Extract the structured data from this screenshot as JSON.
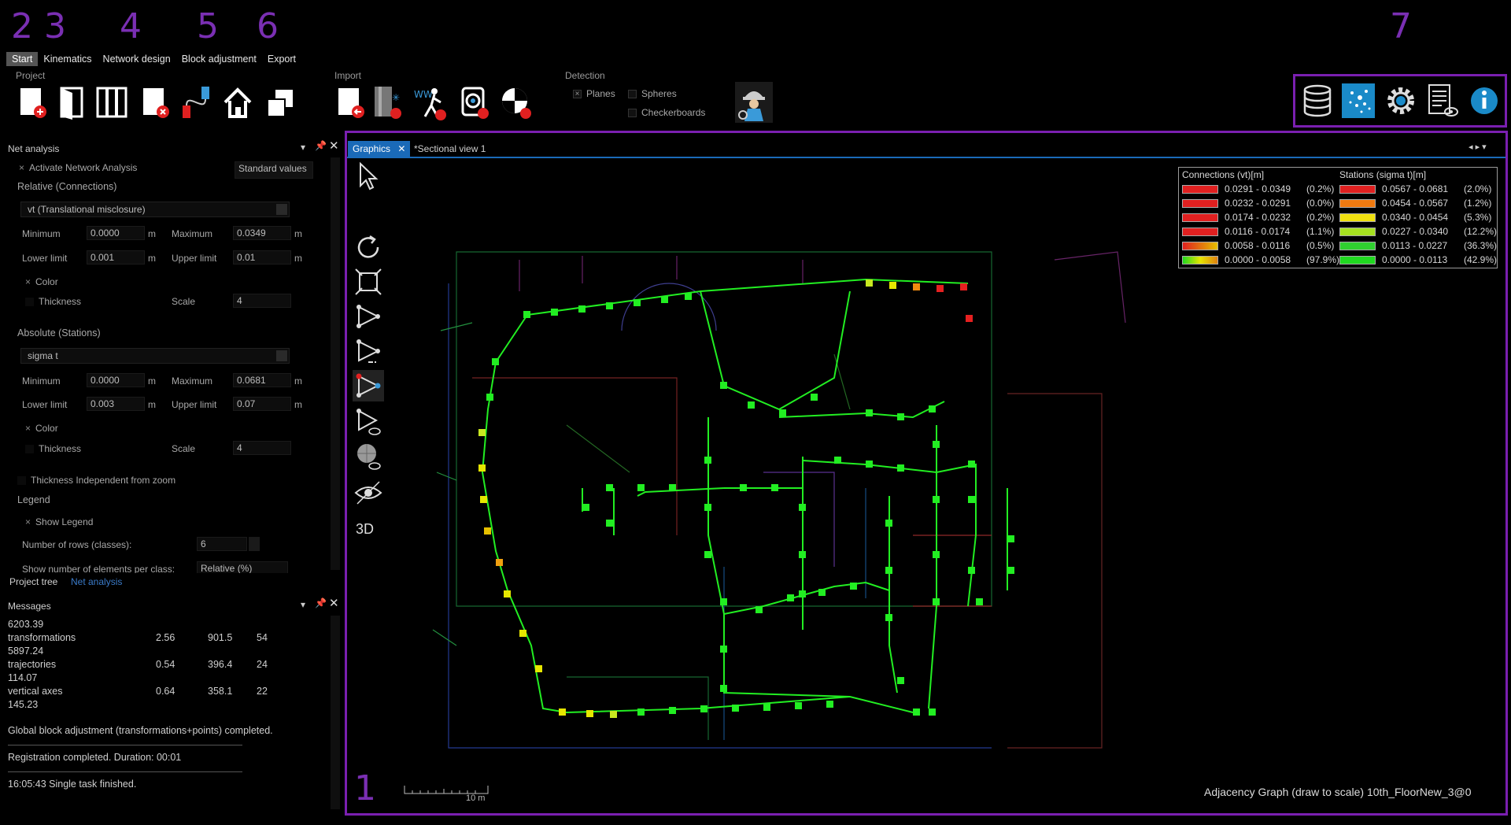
{
  "annotations": [
    "2",
    "3",
    "4",
    "5",
    "6",
    "7",
    "1"
  ],
  "menu": [
    {
      "label": "Start",
      "active": true
    },
    {
      "label": "Kinematics"
    },
    {
      "label": "Network design"
    },
    {
      "label": "Block adjustment"
    },
    {
      "label": "Export"
    }
  ],
  "ribbon": {
    "project_label": "Project",
    "import_label": "Import",
    "detection_label": "Detection",
    "planes": "Planes",
    "spheres": "Spheres",
    "checkerboards": "Checkerboards",
    "planes_checked": "×"
  },
  "net_panel": {
    "title": "Net analysis",
    "activate": "Activate Network Analysis",
    "standard_values": "Standard values",
    "relative_header": "Relative (Connections)",
    "relative_dropdown": "vt (Translational misclosure)",
    "minimum_label": "Minimum",
    "maximum_label": "Maximum",
    "lower_label": "Lower limit",
    "upper_label": "Upper limit",
    "unit": "m",
    "rel_min": "0.0000",
    "rel_max": "0.0349",
    "rel_lower": "0.001",
    "rel_upper": "0.01",
    "color_label": "Color",
    "thickness_label": "Thickness",
    "scale_label": "Scale",
    "rel_scale": "4",
    "absolute_header": "Absolute (Stations)",
    "absolute_dropdown": "sigma t",
    "abs_min": "0.0000",
    "abs_max": "0.0681",
    "abs_lower": "0.003",
    "abs_upper": "0.07",
    "abs_scale": "4",
    "thickness_independent": "Thickness Independent from zoom",
    "legend_header": "Legend",
    "show_legend": "Show Legend",
    "rows_label": "Number of rows (classes):",
    "rows_value": "6",
    "show_number_label": "Show number of elements per class:",
    "show_number_value": "Relative (%)",
    "tab_project_tree": "Project tree",
    "tab_net_analysis": "Net analysis"
  },
  "messages": {
    "title": "Messages",
    "lines": [
      {
        "text": "6203.39"
      },
      {
        "text": "transformations",
        "c1": "2.56",
        "c2": "901.5",
        "c3": "54"
      },
      {
        "text": "5897.24"
      },
      {
        "text": "trajectories",
        "c1": "0.54",
        "c2": "396.4",
        "c3": "24"
      },
      {
        "text": "114.07"
      },
      {
        "text": "vertical axes",
        "c1": "0.64",
        "c2": "358.1",
        "c3": "22"
      },
      {
        "text": "145.23"
      }
    ],
    "block_done": "Global block adjustment (transformations+points) completed.",
    "registration": "Registration completed. Duration: 00:01",
    "single_task": "16:05:43 Single task finished."
  },
  "graphics": {
    "tab_graphics": "Graphics",
    "tab_sectional": "*Sectional view 1",
    "tool_3d": "3D",
    "scale_bar": "10 m",
    "status": "Adjacency Graph (draw to scale) 10th_FloorNew_3@0"
  },
  "legend": {
    "conn_header": "Connections (vt)[m]",
    "stat_header": "Stations (sigma t)[m]",
    "conn": [
      {
        "range": "0.0291 - 0.0349",
        "pct": "(0.2%)",
        "color": "#e02020"
      },
      {
        "range": "0.0232 - 0.0291",
        "pct": "(0.0%)",
        "color": "#e02020"
      },
      {
        "range": "0.0174 - 0.0232",
        "pct": "(0.2%)",
        "color": "#e02020"
      },
      {
        "range": "0.0116 - 0.0174",
        "pct": "(1.1%)",
        "color": "#e02020"
      },
      {
        "range": "0.0058 - 0.0116",
        "pct": "(0.5%)",
        "color": "#e02020"
      },
      {
        "range": "0.0000 - 0.0058",
        "pct": "(97.9%)",
        "color": "#c8d820"
      }
    ],
    "stat": [
      {
        "range": "0.0567 - 0.0681",
        "pct": "(2.0%)",
        "color": "#e02020"
      },
      {
        "range": "0.0454 - 0.0567",
        "pct": "(1.2%)",
        "color": "#f07a10"
      },
      {
        "range": "0.0340 - 0.0454",
        "pct": "(5.3%)",
        "color": "#f0e010"
      },
      {
        "range": "0.0227 - 0.0340",
        "pct": "(12.2%)",
        "color": "#a6e020"
      },
      {
        "range": "0.0113 - 0.0227",
        "pct": "(36.3%)",
        "color": "#30d030"
      },
      {
        "range": "0.0000 - 0.0113",
        "pct": "(42.9%)",
        "color": "#20d820"
      }
    ]
  },
  "map_colors": {
    "station": "#22ee22",
    "edge": "#22ee22",
    "warn": "#e6e600",
    "orange": "#f08a10",
    "red": "#e62020"
  }
}
